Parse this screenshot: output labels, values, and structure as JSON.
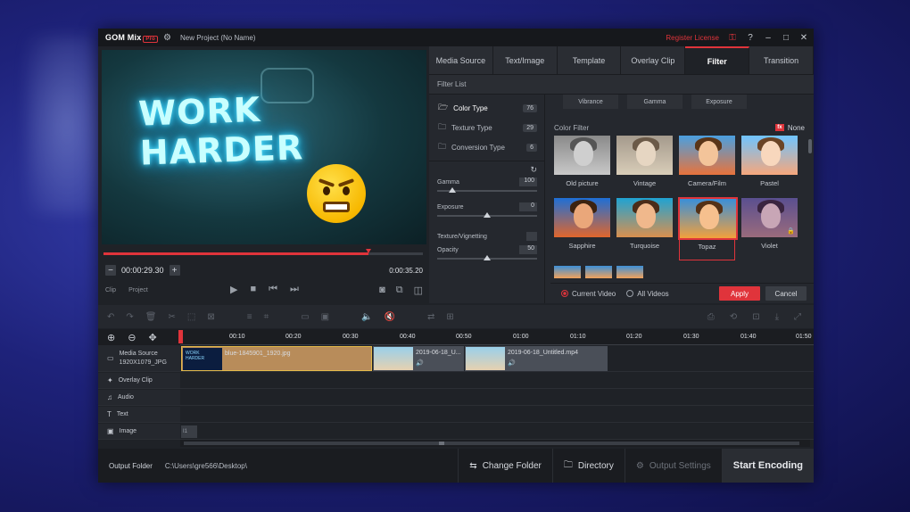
{
  "window": {
    "logo": "GOM Mix",
    "logo_badge": "Pro",
    "title": "New Project (No Name)",
    "register_license": "Register License",
    "help": "?",
    "minimize": "–",
    "maximize": "□",
    "close": "✕"
  },
  "preview": {
    "neon_text": "WORK HARDER",
    "progress_fraction": 0.83,
    "current_time": "00:00:29.30",
    "total_time": "0:00:35.20",
    "mode_clip": "Clip",
    "mode_project": "Project"
  },
  "tabs": [
    {
      "label": "Media Source"
    },
    {
      "label": "Text/Image"
    },
    {
      "label": "Template"
    },
    {
      "label": "Overlay Clip"
    },
    {
      "label": "Filter"
    },
    {
      "label": "Transition"
    }
  ],
  "filter": {
    "list_header": "Filter List",
    "types": [
      {
        "label": "Color Type",
        "count": "76"
      },
      {
        "label": "Texture Type",
        "count": "29"
      },
      {
        "label": "Conversion Type",
        "count": "6"
      }
    ],
    "sliders": [
      {
        "label": "Gamma",
        "value": "100",
        "fraction": 0.15
      },
      {
        "label": "Exposure",
        "value": "0",
        "fraction": 0.5
      },
      {
        "label": "Opacity",
        "value": "50",
        "fraction": 0.5
      }
    ],
    "texture_label": "Texture/Vignetting",
    "top_chips": [
      "Vibrance",
      "Gamma",
      "Exposure"
    ],
    "color_filter_header": "Color Filter",
    "fx_label": "fx",
    "none_label": "None",
    "thumbs": [
      {
        "label": "Old picture"
      },
      {
        "label": "Vintage"
      },
      {
        "label": "Camera/Film"
      },
      {
        "label": "Pastel"
      },
      {
        "label": "Sapphire"
      },
      {
        "label": "Turquoise"
      },
      {
        "label": "Topaz"
      },
      {
        "label": "Violet"
      }
    ],
    "radio_current": "Current Video",
    "radio_all": "All Videos",
    "apply": "Apply",
    "cancel": "Cancel"
  },
  "timeline": {
    "ticks": [
      "00:10",
      "00:20",
      "00:30",
      "00:40",
      "00:50",
      "01:00",
      "01:10",
      "01:20",
      "01:30",
      "01:40",
      "01:50"
    ],
    "tracks": [
      {
        "label": "Media Source",
        "sub": "1920X1079_JPG"
      },
      {
        "label": "Overlay Clip"
      },
      {
        "label": "Audio"
      },
      {
        "label": "Text"
      },
      {
        "label": "Image"
      }
    ],
    "clips": [
      {
        "name": "blue-1845901_1920.jpg",
        "thumb_text": "WORK HARDER"
      },
      {
        "name": "2019-06-18_U...",
        "audio_icon": "🔊"
      },
      {
        "name": "2019-06-18_Untitled.mp4",
        "audio_icon": "🔊"
      }
    ],
    "image_marker": "I1"
  },
  "bottom": {
    "output_folder_label": "Output Folder",
    "output_path": "C:\\Users\\gre566\\Desktop\\",
    "change_folder": "Change Folder",
    "directory": "Directory",
    "output_settings": "Output Settings",
    "start_encoding": "Start Encoding"
  },
  "colors": {
    "accent": "#e0343b",
    "panel": "#25282e",
    "background": "#1f2227"
  }
}
